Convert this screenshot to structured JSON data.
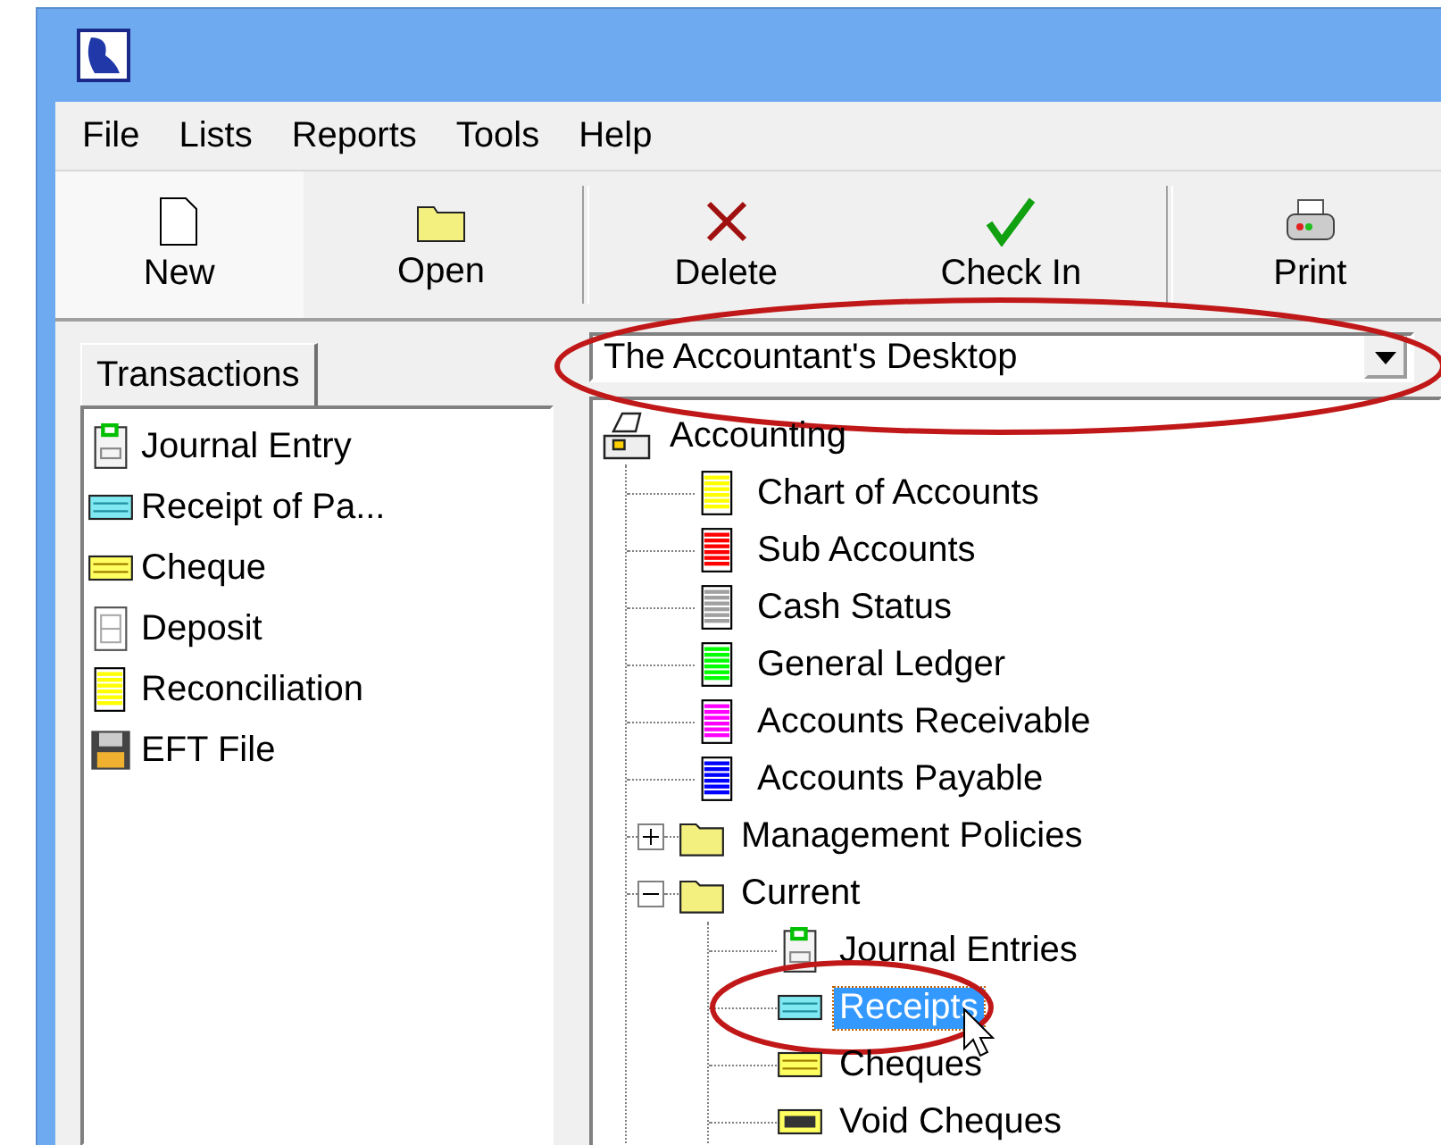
{
  "menu": [
    "File",
    "Lists",
    "Reports",
    "Tools",
    "Help"
  ],
  "toolbar": [
    {
      "label": "New",
      "kind": "new",
      "separator_before": false
    },
    {
      "label": "Open",
      "kind": "open",
      "separator_before": false
    },
    {
      "label": "Delete",
      "kind": "delete",
      "separator_before": true
    },
    {
      "label": "Check In",
      "kind": "checkin",
      "separator_before": false
    },
    {
      "label": "Print",
      "kind": "print",
      "separator_before": true
    }
  ],
  "left_tab": {
    "label": "Transactions",
    "selected": true
  },
  "transactions": [
    {
      "label": "Journal Entry",
      "kind": "journal"
    },
    {
      "label": "Receipt of Pa...",
      "kind": "receipt"
    },
    {
      "label": "Cheque",
      "kind": "cheque"
    },
    {
      "label": "Deposit",
      "kind": "deposit"
    },
    {
      "label": "Reconciliation",
      "kind": "doc",
      "color": "#ffff00"
    },
    {
      "label": "EFT File",
      "kind": "disk"
    }
  ],
  "desktop_select": {
    "value": "The Accountant's Desktop",
    "circled": true
  },
  "tree": [
    {
      "label": "Accounting",
      "kind": "cabinet",
      "selected": false,
      "children": [
        {
          "label": "Chart of Accounts",
          "kind": "doc",
          "color": "#ffff00",
          "selected": false,
          "circled": false
        },
        {
          "label": "Sub Accounts",
          "kind": "doc",
          "color": "#ff0000",
          "selected": false,
          "circled": false
        },
        {
          "label": "Cash Status",
          "kind": "doc",
          "color": "#a0a0a0",
          "selected": false,
          "circled": false
        },
        {
          "label": "General Ledger",
          "kind": "doc",
          "color": "#00ff00",
          "selected": false,
          "circled": false
        },
        {
          "label": "Accounts Receivable",
          "kind": "doc",
          "color": "#ff00ff",
          "selected": false,
          "circled": false
        },
        {
          "label": "Accounts Payable",
          "kind": "doc",
          "color": "#0000ff",
          "selected": false,
          "circled": false
        },
        {
          "label": "Management Policies",
          "kind": "folder",
          "selected": false,
          "circled": false,
          "expanded": false
        },
        {
          "label": "Current",
          "kind": "folder",
          "selected": false,
          "circled": false,
          "expanded": true,
          "children": [
            {
              "label": "Journal Entries",
              "kind": "journal",
              "selected": false,
              "circled": false
            },
            {
              "label": "Receipts",
              "kind": "receipt",
              "selected": true,
              "circled": true
            },
            {
              "label": "Cheques",
              "kind": "cheque",
              "selected": false,
              "circled": false
            },
            {
              "label": "Void Cheques",
              "kind": "void",
              "selected": false,
              "circled": false
            }
          ]
        }
      ]
    }
  ]
}
